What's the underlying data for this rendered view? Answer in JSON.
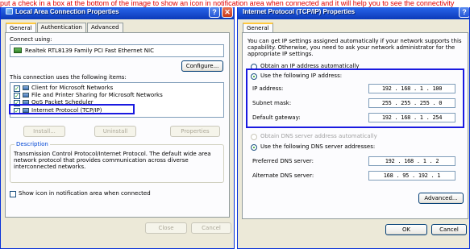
{
  "headline": "put a check in a box at the bottom of the image to show an icon in notification area when connected and it will help you to see the connectivity",
  "left_window": {
    "title": "Local Area Connection Properties",
    "help_glyph": "?",
    "close_glyph": "✕",
    "tabs": [
      "General",
      "Authentication",
      "Advanced"
    ],
    "connect_using_label": "Connect using:",
    "adapter_name": "Realtek RTL8139 Family PCI Fast Ethernet NIC",
    "configure_button": "Configure...",
    "items_label": "This connection uses the following items:",
    "items": [
      {
        "label": "Client for Microsoft Networks",
        "checked": true
      },
      {
        "label": "File and Printer Sharing for Microsoft Networks",
        "checked": true
      },
      {
        "label": "QoS Packet Scheduler",
        "checked": true
      },
      {
        "label": "Internet Protocol (TCP/IP)",
        "checked": true
      }
    ],
    "item_buttons": {
      "install": "Install...",
      "uninstall": "Uninstall",
      "properties": "Properties"
    },
    "description_legend": "Description",
    "description_text": "Transmission Control Protocol/Internet Protocol. The default wide area network protocol that provides communication across diverse interconnected networks.",
    "show_icon_label": "Show icon in notification area when connected",
    "close_button": "Close",
    "cancel_button": "Cancel"
  },
  "right_window": {
    "title": "Internet Protocol (TCP/IP) Properties",
    "help_glyph": "?",
    "tab": "General",
    "intro": "You can get IP settings assigned automatically if your network supports this capability. Otherwise, you need to ask your network administrator for the appropriate IP settings.",
    "obtain_ip_auto": "Obtain an IP address automatically",
    "use_following_ip": "Use the following IP address:",
    "ip_address_label": "IP address:",
    "ip_address": "192 . 168 . 1 . 100",
    "subnet_mask_label": "Subnet mask:",
    "subnet_mask": "255 . 255 . 255 . 0",
    "gateway_label": "Default gateway:",
    "gateway": "192 . 168 . 1 . 254",
    "obtain_dns_auto": "Obtain DNS server address automatically",
    "use_following_dns": "Use the following DNS server addresses:",
    "preferred_dns_label": "Preferred DNS server:",
    "preferred_dns": "192 . 168 . 1 . 2",
    "alternate_dns_label": "Alternate DNS server:",
    "alternate_dns": "168 . 95 . 192 . 1",
    "advanced_button": "Advanced...",
    "ok_button": "OK",
    "cancel_button": "Cancel"
  },
  "colors": {
    "annotation_text": "#e10000",
    "highlight_box": "#1a1ae0",
    "title_bar": "#1a4fd1"
  }
}
